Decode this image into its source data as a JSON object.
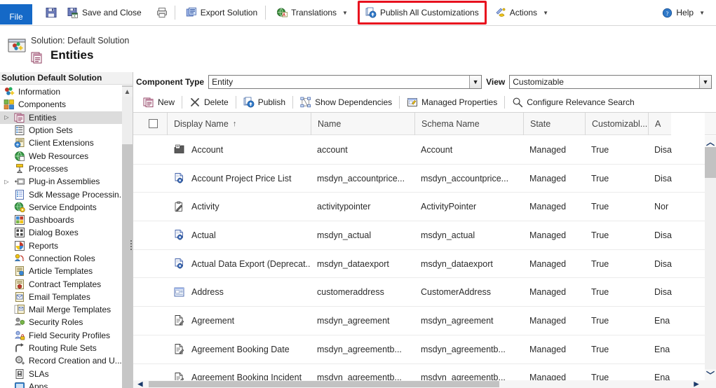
{
  "ribbon": {
    "file_tab": "File",
    "save_icon": "save-icon",
    "save_and_close_label": "Save and Close",
    "save_and_close_icon": "save-and-close-icon",
    "print_icon": "print-icon",
    "export_solution_label": "Export Solution",
    "export_solution_icon": "export-solution-icon",
    "translations_label": "Translations",
    "translations_icon": "translations-icon",
    "publish_all_label": "Publish All Customizations",
    "publish_all_icon": "publish-icon",
    "actions_label": "Actions",
    "actions_icon": "actions-icon",
    "help_label": "Help",
    "help_icon": "help-icon",
    "highlight_color": "#e8101e",
    "file_tab_color": "#1569c7"
  },
  "header": {
    "solution_line": "Solution: Default Solution",
    "title": "Entities",
    "solution_icon": "solution-icon",
    "entities_icon": "entities-icon"
  },
  "sidebar": {
    "header": "Solution Default Solution",
    "items": [
      {
        "label": "Information",
        "icon": "information-icon",
        "level": 0,
        "expandable": false,
        "selected": false
      },
      {
        "label": "Components",
        "icon": "components-icon",
        "level": 0,
        "expandable": false,
        "selected": false
      },
      {
        "label": "Entities",
        "icon": "entities-icon",
        "level": 1,
        "expandable": true,
        "selected": true
      },
      {
        "label": "Option Sets",
        "icon": "option-sets-icon",
        "level": 1,
        "expandable": false,
        "selected": false
      },
      {
        "label": "Client Extensions",
        "icon": "client-extensions-icon",
        "level": 1,
        "expandable": false,
        "selected": false
      },
      {
        "label": "Web Resources",
        "icon": "web-resources-icon",
        "level": 1,
        "expandable": false,
        "selected": false
      },
      {
        "label": "Processes",
        "icon": "processes-icon",
        "level": 1,
        "expandable": false,
        "selected": false
      },
      {
        "label": "Plug-in Assemblies",
        "icon": "plugin-assemblies-icon",
        "level": 1,
        "expandable": true,
        "selected": false
      },
      {
        "label": "Sdk Message Processin...",
        "icon": "sdk-message-icon",
        "level": 1,
        "expandable": false,
        "selected": false
      },
      {
        "label": "Service Endpoints",
        "icon": "service-endpoints-icon",
        "level": 1,
        "expandable": false,
        "selected": false
      },
      {
        "label": "Dashboards",
        "icon": "dashboards-icon",
        "level": 1,
        "expandable": false,
        "selected": false
      },
      {
        "label": "Dialog Boxes",
        "icon": "dialog-boxes-icon",
        "level": 1,
        "expandable": false,
        "selected": false
      },
      {
        "label": "Reports",
        "icon": "reports-icon",
        "level": 1,
        "expandable": false,
        "selected": false
      },
      {
        "label": "Connection Roles",
        "icon": "connection-roles-icon",
        "level": 1,
        "expandable": false,
        "selected": false
      },
      {
        "label": "Article Templates",
        "icon": "article-templates-icon",
        "level": 1,
        "expandable": false,
        "selected": false
      },
      {
        "label": "Contract Templates",
        "icon": "contract-templates-icon",
        "level": 1,
        "expandable": false,
        "selected": false
      },
      {
        "label": "Email Templates",
        "icon": "email-templates-icon",
        "level": 1,
        "expandable": false,
        "selected": false
      },
      {
        "label": "Mail Merge Templates",
        "icon": "mail-merge-templates-icon",
        "level": 1,
        "expandable": false,
        "selected": false
      },
      {
        "label": "Security Roles",
        "icon": "security-roles-icon",
        "level": 1,
        "expandable": false,
        "selected": false
      },
      {
        "label": "Field Security Profiles",
        "icon": "field-security-profiles-icon",
        "level": 1,
        "expandable": false,
        "selected": false
      },
      {
        "label": "Routing Rule Sets",
        "icon": "routing-rule-sets-icon",
        "level": 1,
        "expandable": false,
        "selected": false
      },
      {
        "label": "Record Creation and U...",
        "icon": "record-creation-icon",
        "level": 1,
        "expandable": false,
        "selected": false
      },
      {
        "label": "SLAs",
        "icon": "slas-icon",
        "level": 1,
        "expandable": false,
        "selected": false
      },
      {
        "label": "Apps",
        "icon": "apps-icon",
        "level": 1,
        "expandable": false,
        "selected": false
      }
    ]
  },
  "filters": {
    "component_type_label": "Component Type",
    "component_type_value": "Entity",
    "view_label": "View",
    "view_value": "Customizable"
  },
  "actions": [
    {
      "label": "New",
      "icon": "new-icon"
    },
    {
      "label": "Delete",
      "icon": "delete-icon"
    },
    {
      "label": "Publish",
      "icon": "publish-icon"
    },
    {
      "label": "Show Dependencies",
      "icon": "show-dependencies-icon"
    },
    {
      "label": "Managed Properties",
      "icon": "managed-properties-icon"
    },
    {
      "label": "Configure Relevance Search",
      "icon": "search-icon"
    }
  ],
  "grid": {
    "columns": [
      {
        "label": "Display Name",
        "sorted": true,
        "sort_arrow": "↑"
      },
      {
        "label": "Name",
        "sorted": false,
        "sort_arrow": ""
      },
      {
        "label": "Schema Name",
        "sorted": false,
        "sort_arrow": ""
      },
      {
        "label": "State",
        "sorted": false,
        "sort_arrow": ""
      },
      {
        "label": "Customizabl...",
        "sorted": false,
        "sort_arrow": ""
      },
      {
        "label": "A",
        "sorted": false,
        "sort_arrow": ""
      }
    ],
    "rows": [
      {
        "display_name": "Account",
        "name": "account",
        "schema_name": "Account",
        "state": "Managed",
        "customizable": "True",
        "audit": "Disa",
        "icon": "entity-account-icon"
      },
      {
        "display_name": "Account Project Price List",
        "name": "msdyn_accountprice...",
        "schema_name": "msdyn_accountprice...",
        "state": "Managed",
        "customizable": "True",
        "audit": "Disa",
        "icon": "entity-gear-icon"
      },
      {
        "display_name": "Activity",
        "name": "activitypointer",
        "schema_name": "ActivityPointer",
        "state": "Managed",
        "customizable": "True",
        "audit": "Nor",
        "icon": "entity-clipboard-icon"
      },
      {
        "display_name": "Actual",
        "name": "msdyn_actual",
        "schema_name": "msdyn_actual",
        "state": "Managed",
        "customizable": "True",
        "audit": "Disa",
        "icon": "entity-gear-icon"
      },
      {
        "display_name": "Actual Data Export (Deprecat...",
        "name": "msdyn_dataexport",
        "schema_name": "msdyn_dataexport",
        "state": "Managed",
        "customizable": "True",
        "audit": "Disa",
        "icon": "entity-gear-icon"
      },
      {
        "display_name": "Address",
        "name": "customeraddress",
        "schema_name": "CustomerAddress",
        "state": "Managed",
        "customizable": "True",
        "audit": "Disa",
        "icon": "entity-address-icon"
      },
      {
        "display_name": "Agreement",
        "name": "msdyn_agreement",
        "schema_name": "msdyn_agreement",
        "state": "Managed",
        "customizable": "True",
        "audit": "Ena",
        "icon": "entity-doc-icon"
      },
      {
        "display_name": "Agreement Booking Date",
        "name": "msdyn_agreementb...",
        "schema_name": "msdyn_agreementb...",
        "state": "Managed",
        "customizable": "True",
        "audit": "Ena",
        "icon": "entity-doc-icon"
      },
      {
        "display_name": "Agreement Booking Incident",
        "name": "msdyn_agreementb...",
        "schema_name": "msdyn_agreementb...",
        "state": "Managed",
        "customizable": "True",
        "audit": "Ena",
        "icon": "entity-doc-icon"
      }
    ]
  }
}
